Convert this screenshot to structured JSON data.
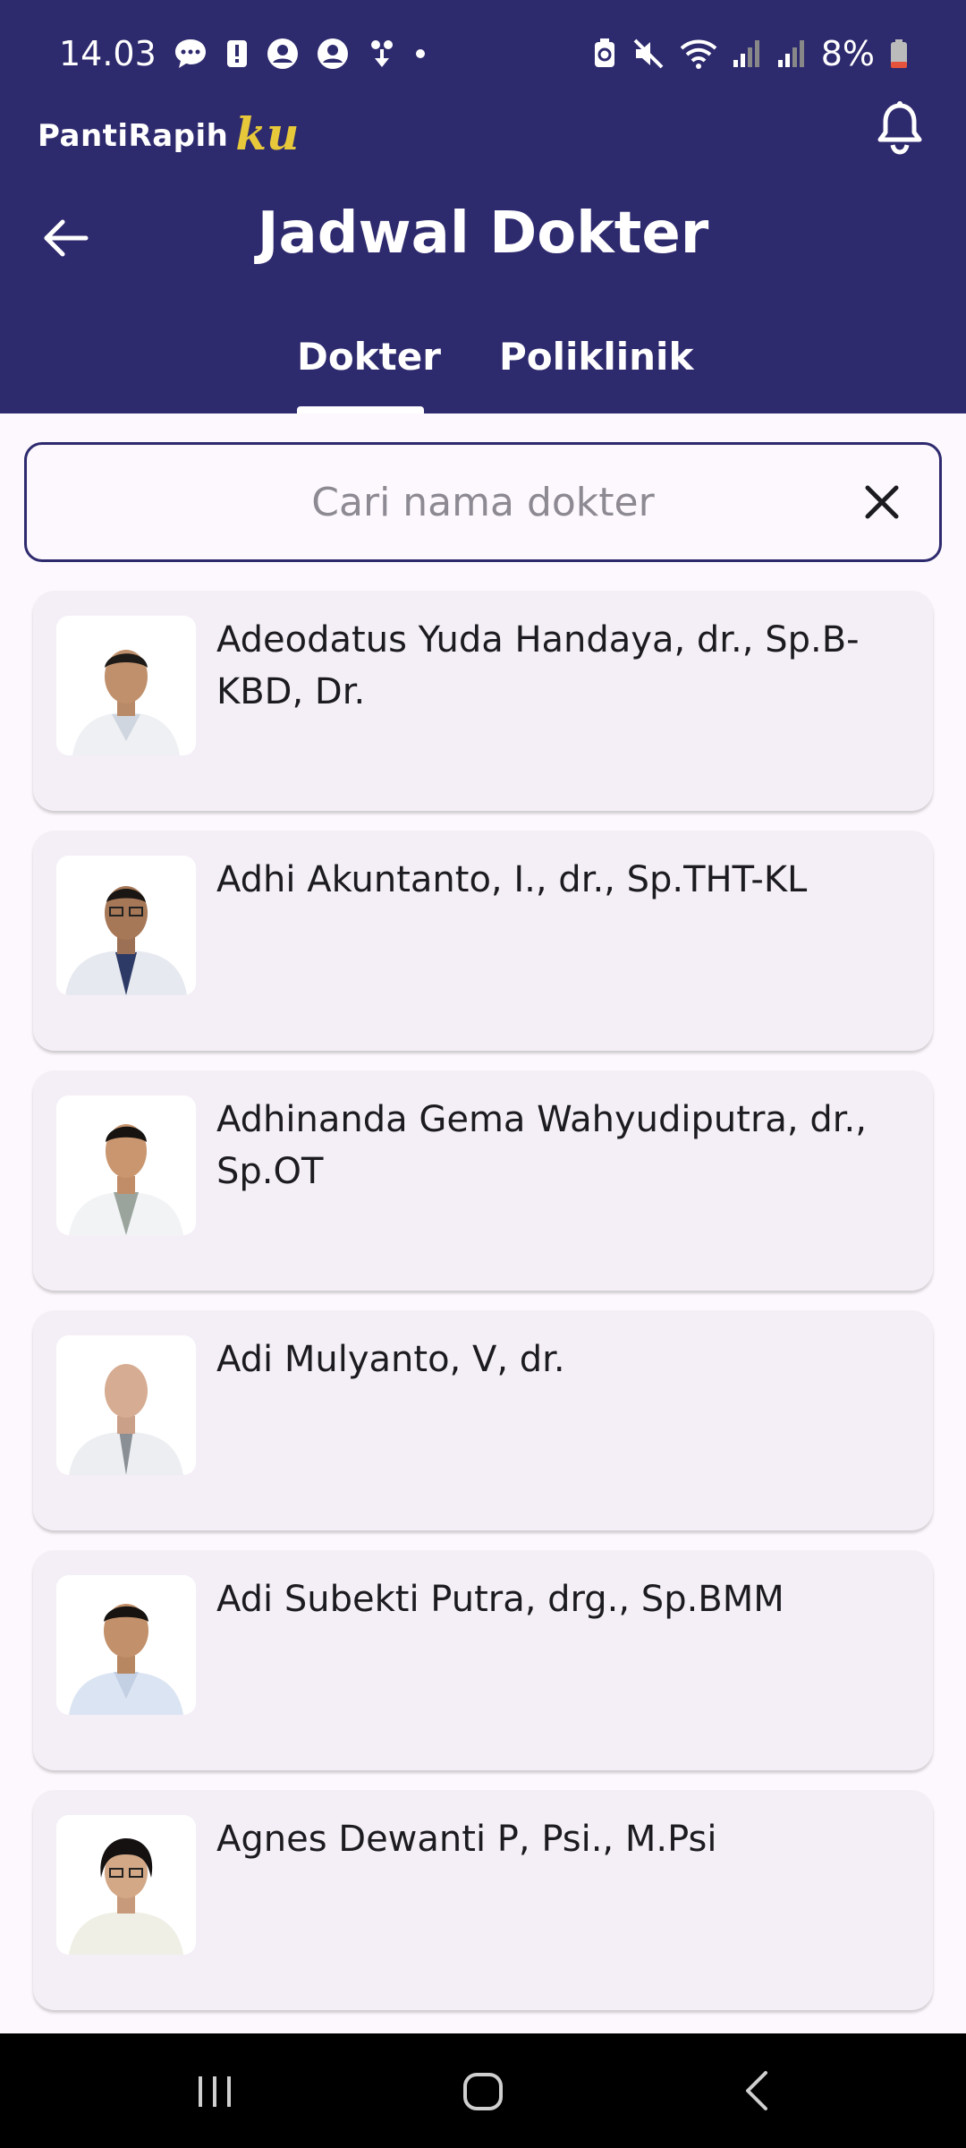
{
  "status_bar": {
    "time": "14.03",
    "battery": "8%"
  },
  "header": {
    "logo_main": "PantiRapih",
    "logo_ku": "ku",
    "title": "Jadwal Dokter",
    "tabs": [
      {
        "label": "Dokter",
        "selected": true
      },
      {
        "label": "Poliklinik",
        "selected": false
      }
    ]
  },
  "search": {
    "placeholder": "Cari nama dokter",
    "value": ""
  },
  "doctors": [
    {
      "name": "Adeodatus Yuda Handaya, dr., Sp.B-KBD, Dr."
    },
    {
      "name": "Adhi Akuntanto, I., dr., Sp.THT-KL"
    },
    {
      "name": "Adhinanda Gema Wahyudiputra, dr., Sp.OT"
    },
    {
      "name": "Adi Mulyanto, V, dr."
    },
    {
      "name": "Adi Subekti Putra, drg., Sp.BMM"
    },
    {
      "name": "Agnes Dewanti P, Psi., M.Psi"
    }
  ],
  "colors": {
    "header_bg": "#2e2a6e",
    "logo_accent": "#e6c83a",
    "card_bg": "#f4eff6",
    "page_bg": "#fcf8fd"
  }
}
